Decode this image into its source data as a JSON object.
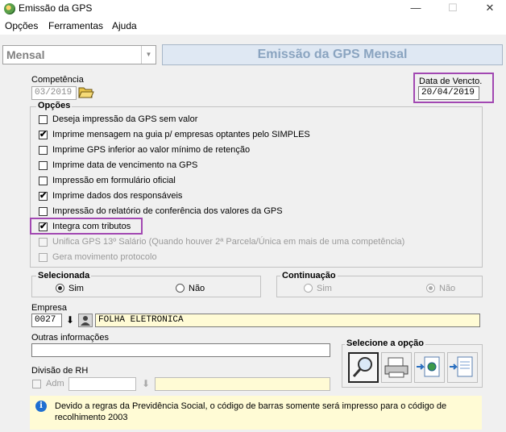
{
  "window": {
    "title": "Emissão da GPS",
    "minimize_glyph": "—",
    "maximize_glyph": "☐",
    "close_glyph": "✕"
  },
  "menu": {
    "items": [
      "Opções",
      "Ferramentas",
      "Ajuda"
    ]
  },
  "header": {
    "mode_value": "Mensal",
    "title": "Emissão da GPS Mensal"
  },
  "competencia": {
    "label": "Competência",
    "value": "03/2019"
  },
  "vencimento": {
    "label": "Data de Vencto.",
    "value": "20/04/2019"
  },
  "opcoes": {
    "title": "Opções",
    "items": [
      {
        "label": "Deseja impressão da GPS sem valor",
        "checked": false,
        "enabled": true
      },
      {
        "label": "Imprime mensagem na guia p/ empresas optantes pelo SIMPLES",
        "checked": true,
        "enabled": true
      },
      {
        "label": "Imprime GPS inferior ao valor mínimo de retenção",
        "checked": false,
        "enabled": true
      },
      {
        "label": "Imprime data de vencimento na GPS",
        "checked": false,
        "enabled": true
      },
      {
        "label": "Impressão em formulário oficial",
        "checked": false,
        "enabled": true
      },
      {
        "label": "Imprime dados dos responsáveis",
        "checked": true,
        "enabled": true
      },
      {
        "label": "Impressão do relatório de conferência dos valores da GPS",
        "checked": false,
        "enabled": true
      },
      {
        "label": "Integra com tributos",
        "checked": true,
        "enabled": true
      },
      {
        "label": "Unifica GPS 13º Salário (Quando houver 2ª Parcela/Única em mais de uma competência)",
        "checked": false,
        "enabled": false
      },
      {
        "label": "Gera movimento protocolo",
        "checked": false,
        "enabled": false
      }
    ]
  },
  "selecionada": {
    "title": "Selecionada",
    "sim": "Sim",
    "nao": "Não"
  },
  "continuacao": {
    "title": "Continuação",
    "sim": "Sim",
    "nao": "Não"
  },
  "empresa": {
    "label": "Empresa",
    "code": "0027",
    "name": "FOLHA ELETRONICA"
  },
  "outras": {
    "label": "Outras informações",
    "value": ""
  },
  "selecione": {
    "title": "Selecione a opção"
  },
  "divisao": {
    "label": "Divisão de RH",
    "adm_label": "Adm",
    "code": "",
    "name": ""
  },
  "info": {
    "text": "Devido a regras da Previdência Social, o código de barras somente será impresso para o código de recolhimento 2003"
  },
  "colors": {
    "highlight": "#a248b2",
    "yellow_field": "#fffbd5",
    "header_text": "#8aa4c0"
  },
  "icons": [
    "app-gps-icon",
    "folder-open-icon",
    "down-arrow-icon",
    "person-search-icon",
    "magnifier-icon",
    "printer-icon",
    "globe-export-icon",
    "document-export-icon",
    "info-icon"
  ]
}
